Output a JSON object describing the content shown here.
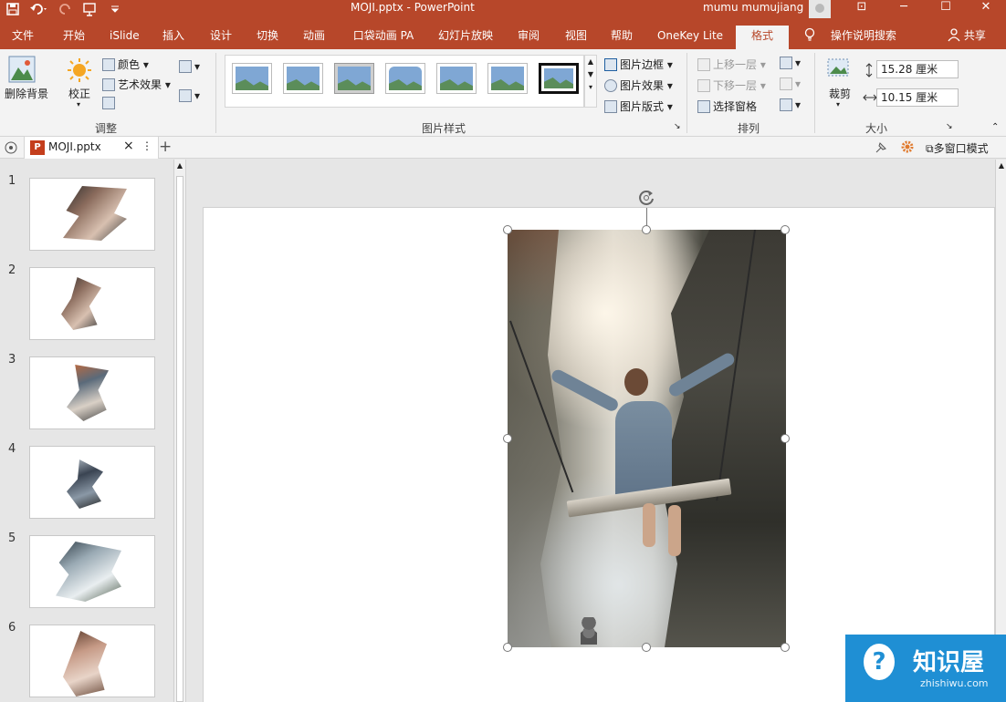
{
  "app": {
    "title": "MOJI.pptx  -  PowerPoint",
    "user": "mumu mumujiang",
    "window_controls": [
      "⊡",
      "─",
      "☐",
      "✕"
    ]
  },
  "tabs": [
    "文件",
    "开始",
    "iSlide",
    "插入",
    "设计",
    "切换",
    "动画",
    "口袋动画 PA",
    "幻灯片放映",
    "审阅",
    "视图",
    "帮助",
    "OneKey Lite",
    "格式"
  ],
  "active_tab": "格式",
  "tellme": "操作说明搜索",
  "share": "共享",
  "ribbon": {
    "remove_bg": "删除背景",
    "corrections": "校正",
    "color": "颜色",
    "artistic": "艺术效果",
    "group_adjust": "调整",
    "picture_border": "图片边框",
    "picture_effects": "图片效果",
    "picture_layout": "图片版式",
    "group_styles": "图片样式",
    "bring_forward": "上移一层",
    "send_backward": "下移一层",
    "selection_pane": "选择窗格",
    "group_arrange": "排列",
    "crop": "裁剪",
    "height": "15.28 厘米",
    "width": "10.15 厘米",
    "group_size": "大小"
  },
  "doc": {
    "tab_name": "MOJI.pptx",
    "multiwindow": "多窗口模式"
  },
  "slides": [
    {
      "num": "1"
    },
    {
      "num": "2"
    },
    {
      "num": "3"
    },
    {
      "num": "4"
    },
    {
      "num": "5"
    },
    {
      "num": "6"
    }
  ],
  "watermark": {
    "name": "知识屋",
    "url": "zhishiwu.com"
  },
  "colors": {
    "accent": "#b7472a",
    "watermark": "#1f8fd4"
  }
}
